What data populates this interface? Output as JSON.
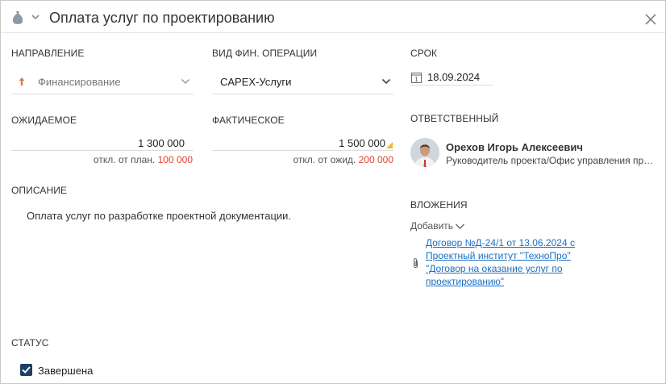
{
  "header": {
    "title": "Оплата услуг по проектированию",
    "icon": "money-bag-icon"
  },
  "direction": {
    "label": "НАПРАВЛЕНИЕ",
    "value": "Финансирование"
  },
  "operation": {
    "label": "ВИД ФИН. ОПЕРАЦИИ",
    "value": "CAPEX-Услуги"
  },
  "deadline": {
    "label": "СРОК",
    "value": "18.09.2024"
  },
  "expected": {
    "label": "ОЖИДАЕМОЕ",
    "value": "1 300 000",
    "deviation_label": "откл. от план.",
    "deviation_value": "100 000"
  },
  "actual": {
    "label": "ФАКТИЧЕСКОЕ",
    "value": "1 500 000",
    "deviation_label": "откл. от ожид.",
    "deviation_value": "200 000"
  },
  "responsible": {
    "label": "ОТВЕТСТВЕННЫЙ",
    "name": "Орехов Игорь Алексеевич",
    "role": "Руководитель проекта/Офис управления проектами"
  },
  "description": {
    "label": "ОПИСАНИЕ",
    "text": "Оплата услуг по разработке проектной документации."
  },
  "attachments": {
    "label": "ВЛОЖЕНИЯ",
    "add_label": "Добавить",
    "items": [
      {
        "text": "Договор №Д-24/1 от 13.06.2024 с Проектный институт \"ТехноПро\" \"Договор на оказание услуг по проектированию\""
      }
    ]
  },
  "status": {
    "label": "СТАТУС",
    "checkbox_label": "Завершена",
    "checked": true
  },
  "colors": {
    "accent_link": "#1a6fc4",
    "deviation": "#e8412c",
    "checkbox": "#1d3f66",
    "direction_arrow": "#d87c4a"
  }
}
